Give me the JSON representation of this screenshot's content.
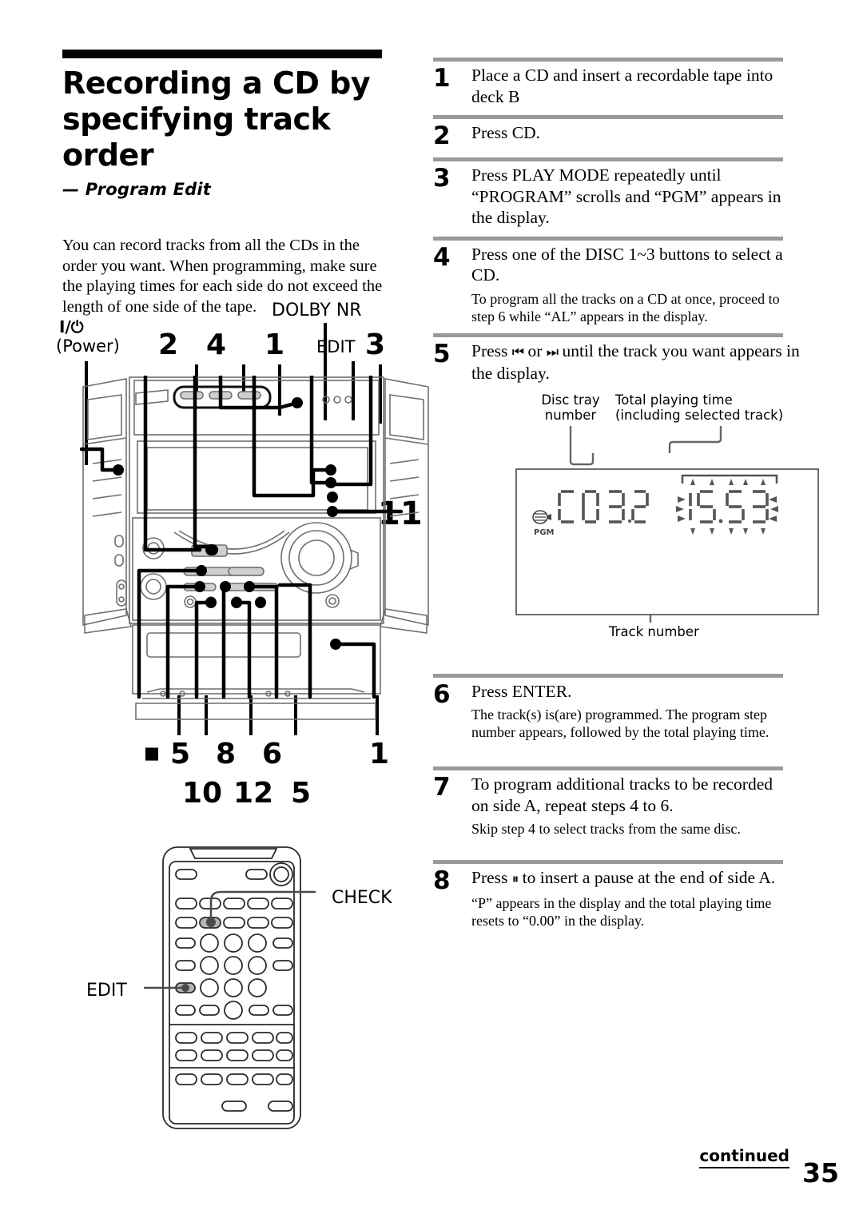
{
  "page": {
    "number": "35",
    "continued_label": "continued"
  },
  "header": {
    "title_line1": "Recording a CD by",
    "title_line2": "specifying track order",
    "subtitle": "— Program Edit",
    "intro": "You can record tracks from all the CDs in the order you want. When programming, make sure the playing times for each side do not exceed the length of one side of the tape."
  },
  "diagram": {
    "power_symbol": "I/⏻",
    "power_label": "(Power)",
    "top_callouts": [
      "2",
      "4",
      "1",
      "3"
    ],
    "dolby_label": "DOLBY NR",
    "edit_label": "EDIT",
    "side_callout": "11",
    "bottom_callouts_row1": [
      "5",
      "8",
      "6",
      "1"
    ],
    "bottom_callouts_row2": [
      "10",
      "12",
      "5"
    ],
    "stop_symbol": "■",
    "remote_check_label": "CHECK",
    "remote_edit_label": "EDIT"
  },
  "steps": [
    {
      "number": "1",
      "main": "Place a CD and insert a recordable tape into deck B",
      "sub": ""
    },
    {
      "number": "2",
      "main": "Press CD.",
      "sub": ""
    },
    {
      "number": "3",
      "main": "Press PLAY MODE repeatedly until “PROGRAM” scrolls and “PGM” appears in the display.",
      "sub": ""
    },
    {
      "number": "4",
      "main": "Press one of the DISC 1~3 buttons to select a CD.",
      "sub": "To program all the tracks on a CD at once, proceed to step 6 while “AL” appears in the display."
    },
    {
      "number": "5",
      "main_pre": "Press ",
      "main_sym1": "⏮",
      "main_mid": " or ",
      "main_sym2": "⏭",
      "main_post": " until the track you want appears in the display.",
      "sub": ""
    },
    {
      "number": "6",
      "main": "Press ENTER.",
      "sub": "The track(s) is(are) programmed.  The program step number appears, followed by the total playing time."
    },
    {
      "number": "7",
      "main": "To program additional tracks to be recorded on side A, repeat steps 4 to 6.",
      "sub": "Skip step 4 to select tracks from the same disc."
    },
    {
      "number": "8",
      "main_pre": "Press ",
      "main_sym1": "⏸",
      "main_post": " to insert a pause at the end of side A.",
      "sub": "“P” appears in the display and the total playing time resets to “0.00” in the display."
    }
  ],
  "lcd": {
    "caption_disc_line1": "Disc tray",
    "caption_disc_line2": "number",
    "caption_time_line1": "Total playing time",
    "caption_time_line2": "(including selected track)",
    "caption_track": "Track number",
    "pgm_label": "PGM",
    "disc_text": "CD 3",
    "track_text": "2",
    "time_text": "15.53"
  },
  "colors": {
    "rule_gray": "#9a9a9a",
    "ink": "#000000",
    "lcd_gray": "#555555"
  }
}
